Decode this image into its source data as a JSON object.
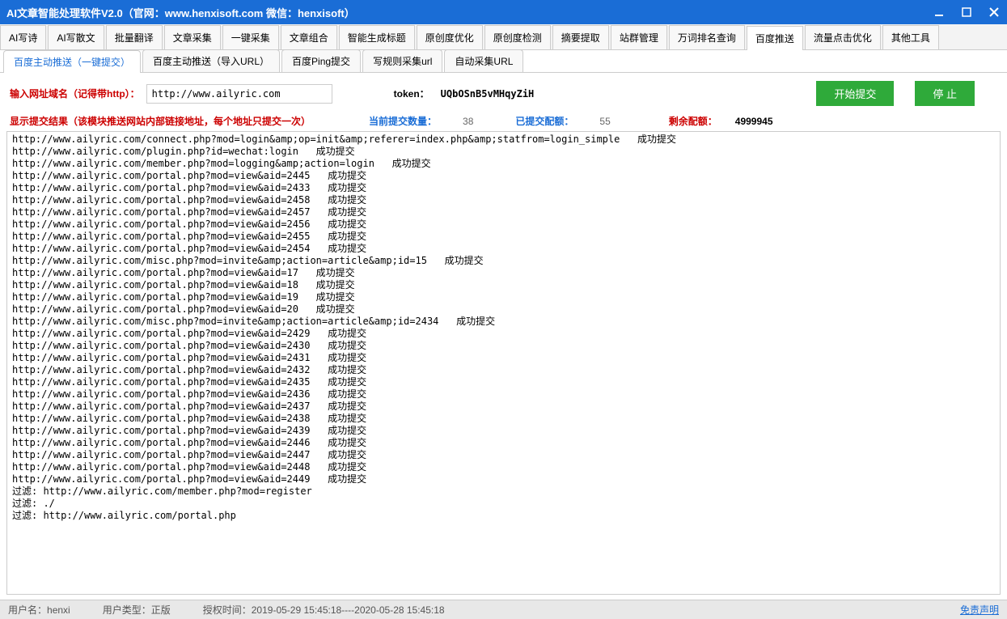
{
  "window": {
    "title": "AI文章智能处理软件V2.0（官网：www.henxisoft.com  微信：henxisoft）"
  },
  "main_tabs": [
    "AI写诗",
    "AI写散文",
    "批量翻译",
    "文章采集",
    "一键采集",
    "文章组合",
    "智能生成标题",
    "原创度优化",
    "原创度检测",
    "摘要提取",
    "站群管理",
    "万词排名查询",
    "百度推送",
    "流量点击优化",
    "其他工具"
  ],
  "main_tab_active": 12,
  "sub_tabs": [
    "百度主动推送（一键提交）",
    "百度主动推送（导入URL）",
    "百度Ping提交",
    "写规则采集url",
    "自动采集URL"
  ],
  "sub_tab_active": 0,
  "form": {
    "url_label": "输入网址域名（记得带http）：",
    "url_value": "http://www.ailyric.com",
    "token_label": "token：",
    "token_value": "UQbOSnB5vMHqyZiH",
    "start_btn": "开始提交",
    "stop_btn": "停 止"
  },
  "status": {
    "result_label": "显示提交结果（该模块推送网站内部链接地址，每个地址只提交一次）",
    "count_label": "当前提交数量：",
    "count_value": "38",
    "submitted_label": "已提交配额：",
    "submitted_value": "55",
    "remain_label": "剩余配额：",
    "remain_value": "4999945"
  },
  "log_lines": [
    "http://www.ailyric.com/connect.php?mod=login&amp;op=init&amp;referer=index.php&amp;statfrom=login_simple   成功提交",
    "http://www.ailyric.com/plugin.php?id=wechat:login   成功提交",
    "http://www.ailyric.com/member.php?mod=logging&amp;action=login   成功提交",
    "http://www.ailyric.com/portal.php?mod=view&aid=2445   成功提交",
    "http://www.ailyric.com/portal.php?mod=view&aid=2433   成功提交",
    "http://www.ailyric.com/portal.php?mod=view&aid=2458   成功提交",
    "http://www.ailyric.com/portal.php?mod=view&aid=2457   成功提交",
    "http://www.ailyric.com/portal.php?mod=view&aid=2456   成功提交",
    "http://www.ailyric.com/portal.php?mod=view&aid=2455   成功提交",
    "http://www.ailyric.com/portal.php?mod=view&aid=2454   成功提交",
    "http://www.ailyric.com/misc.php?mod=invite&amp;action=article&amp;id=15   成功提交",
    "http://www.ailyric.com/portal.php?mod=view&aid=17   成功提交",
    "http://www.ailyric.com/portal.php?mod=view&aid=18   成功提交",
    "http://www.ailyric.com/portal.php?mod=view&aid=19   成功提交",
    "http://www.ailyric.com/portal.php?mod=view&aid=20   成功提交",
    "http://www.ailyric.com/misc.php?mod=invite&amp;action=article&amp;id=2434   成功提交",
    "http://www.ailyric.com/portal.php?mod=view&aid=2429   成功提交",
    "http://www.ailyric.com/portal.php?mod=view&aid=2430   成功提交",
    "http://www.ailyric.com/portal.php?mod=view&aid=2431   成功提交",
    "http://www.ailyric.com/portal.php?mod=view&aid=2432   成功提交",
    "http://www.ailyric.com/portal.php?mod=view&aid=2435   成功提交",
    "http://www.ailyric.com/portal.php?mod=view&aid=2436   成功提交",
    "http://www.ailyric.com/portal.php?mod=view&aid=2437   成功提交",
    "http://www.ailyric.com/portal.php?mod=view&aid=2438   成功提交",
    "http://www.ailyric.com/portal.php?mod=view&aid=2439   成功提交",
    "http://www.ailyric.com/portal.php?mod=view&aid=2446   成功提交",
    "http://www.ailyric.com/portal.php?mod=view&aid=2447   成功提交",
    "http://www.ailyric.com/portal.php?mod=view&aid=2448   成功提交",
    "http://www.ailyric.com/portal.php?mod=view&aid=2449   成功提交",
    "",
    "过滤: http://www.ailyric.com/member.php?mod=register",
    "过滤: ./",
    "过滤: http://www.ailyric.com/portal.php"
  ],
  "footer": {
    "user_label": "用户名：",
    "user_value": "henxi",
    "type_label": "用户类型：",
    "type_value": "正版",
    "auth_label": "授权时间：",
    "auth_value": "2019-05-29 15:45:18----2020-05-28 15:45:18",
    "disclaimer": "免责声明"
  }
}
